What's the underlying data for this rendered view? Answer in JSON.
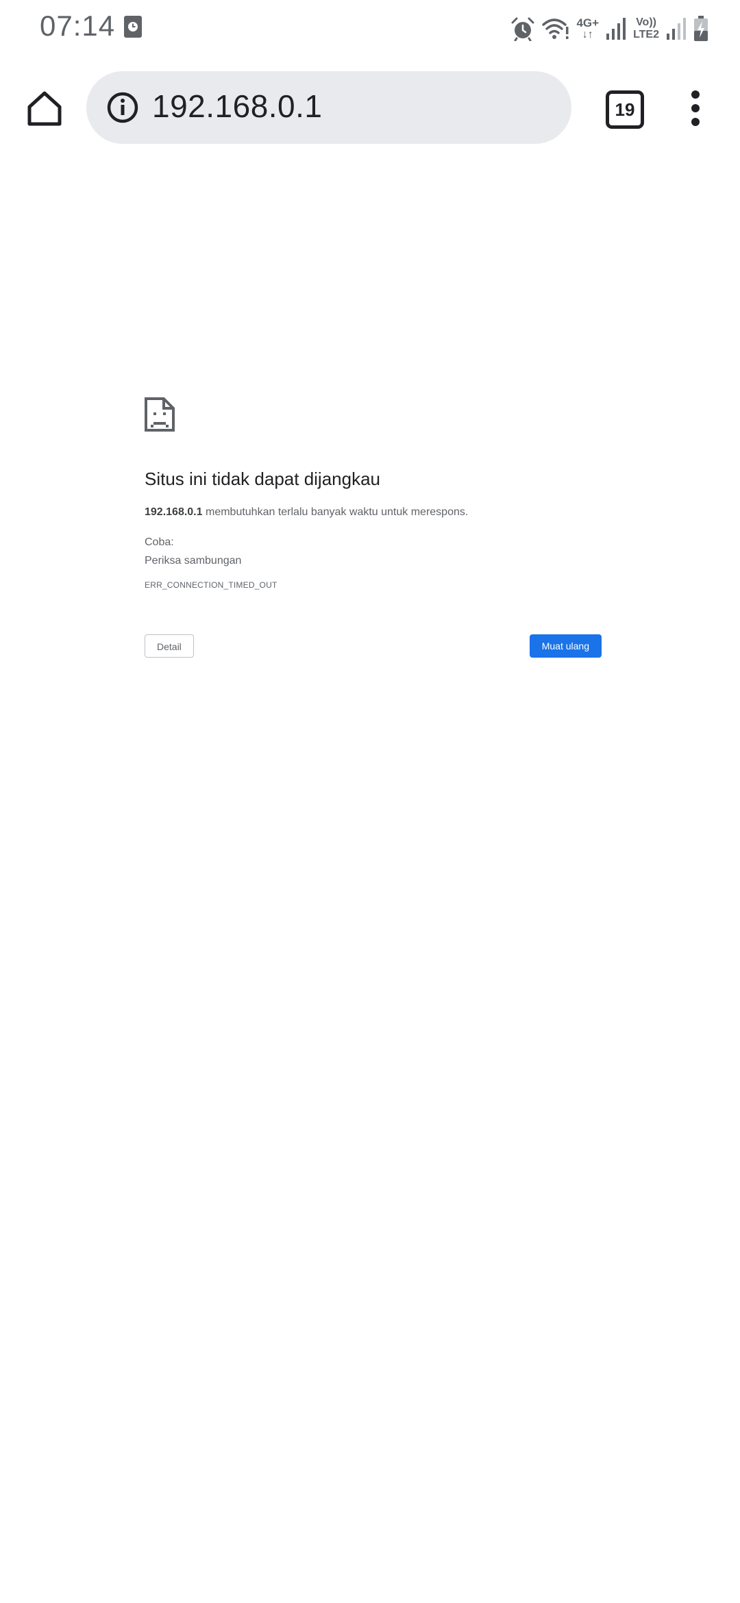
{
  "status_bar": {
    "time": "07:14",
    "network_type": "4G+",
    "network_arrows": "↓↑",
    "volte_top": "Vo))",
    "volte_bottom": "LTE2"
  },
  "toolbar": {
    "url": "192.168.0.1",
    "tab_count": "19"
  },
  "error": {
    "title": "Situs ini tidak dapat dijangkau",
    "host": "192.168.0.1",
    "message": "membutuhkan terlalu banyak waktu untuk merespons.",
    "try_label": "Coba:",
    "suggestion": "Periksa sambungan",
    "code": "ERR_CONNECTION_TIMED_OUT",
    "detail_button": "Detail",
    "reload_button": "Muat ulang"
  },
  "colors": {
    "accent": "#1a73e8",
    "omnibox_bg": "#e9eaed",
    "text_primary": "#202124",
    "text_secondary": "#5f6368"
  },
  "icons": {
    "status_left": "screen-recorder-icon",
    "status_right": [
      "alarm-icon",
      "wifi-icon",
      "signal-icon",
      "signal-icon",
      "battery-charging-icon"
    ],
    "toolbar": [
      "home-icon",
      "info-icon",
      "tab-switcher-icon",
      "more-vert-icon"
    ],
    "error": "sad-document-icon"
  }
}
